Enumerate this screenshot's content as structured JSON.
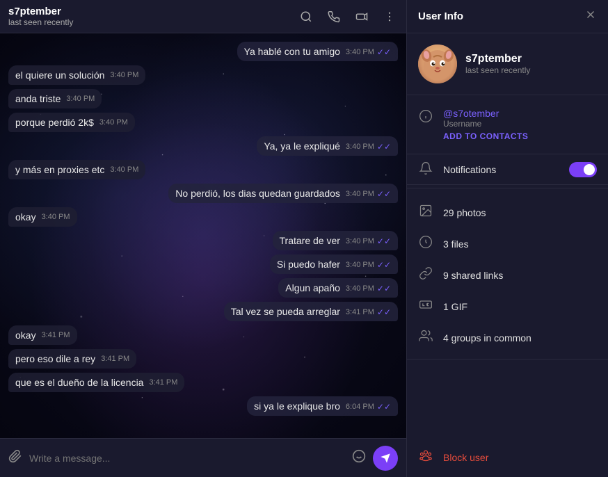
{
  "header": {
    "username": "s7ptember",
    "status": "last seen recently",
    "icons": {
      "search": "🔍",
      "call": "📞",
      "video": "📺",
      "more": "⋮"
    }
  },
  "messages": [
    {
      "id": 1,
      "type": "outgoing",
      "text": "Ya hablé con tu amigo",
      "time": "3:40 PM",
      "ticks": true
    },
    {
      "id": 2,
      "type": "incoming",
      "text": "el quiere un solución",
      "time": "3:40 PM",
      "ticks": false
    },
    {
      "id": 3,
      "type": "incoming",
      "text": "anda triste",
      "time": "3:40 PM",
      "ticks": false
    },
    {
      "id": 4,
      "type": "incoming",
      "text": "porque perdió 2k$",
      "time": "3:40 PM",
      "ticks": false
    },
    {
      "id": 5,
      "type": "outgoing",
      "text": "Ya, ya le expliqué",
      "time": "3:40 PM",
      "ticks": true
    },
    {
      "id": 6,
      "type": "incoming",
      "text": "y más en proxies etc",
      "time": "3:40 PM",
      "ticks": false
    },
    {
      "id": 7,
      "type": "outgoing",
      "text": "No perdió, los dias quedan guardados",
      "time": "3:40 PM",
      "ticks": true
    },
    {
      "id": 8,
      "type": "incoming",
      "text": "okay",
      "time": "3:40 PM",
      "ticks": false
    },
    {
      "id": 9,
      "type": "outgoing",
      "text": "Tratare de ver",
      "time": "3:40 PM",
      "ticks": true
    },
    {
      "id": 10,
      "type": "outgoing",
      "text": "Si puedo hafer",
      "time": "3:40 PM",
      "ticks": true
    },
    {
      "id": 11,
      "type": "outgoing",
      "text": "Algun apaño",
      "time": "3:40 PM",
      "ticks": true
    },
    {
      "id": 12,
      "type": "outgoing",
      "text": "Tal vez se pueda arreglar",
      "time": "3:41 PM",
      "ticks": true
    },
    {
      "id": 13,
      "type": "incoming",
      "text": "okay",
      "time": "3:41 PM",
      "ticks": false
    },
    {
      "id": 14,
      "type": "incoming",
      "text": "pero eso dile a rey",
      "time": "3:41 PM",
      "ticks": false
    },
    {
      "id": 15,
      "type": "incoming",
      "text": "que es el dueño de la licencia",
      "time": "3:41 PM",
      "ticks": false
    },
    {
      "id": 16,
      "type": "outgoing",
      "text": "si ya le explique bro",
      "time": "6:04 PM",
      "ticks": true
    }
  ],
  "input": {
    "placeholder": "Write a message..."
  },
  "userInfo": {
    "title": "User Info",
    "displayName": "s7ptember",
    "lastSeen": "last seen recently",
    "username": "@s7otember",
    "usernameLabel": "Username",
    "addToContacts": "ADD TO CONTACTS",
    "notificationsLabel": "Notifications",
    "notificationsEnabled": true,
    "media": [
      {
        "id": "photos",
        "icon": "photo",
        "label": "29 photos"
      },
      {
        "id": "files",
        "icon": "file",
        "label": "3 files"
      },
      {
        "id": "links",
        "icon": "link",
        "label": "9 shared links"
      },
      {
        "id": "gif",
        "icon": "gif",
        "label": "1 GIF"
      },
      {
        "id": "groups",
        "icon": "groups",
        "label": "4 groups in common"
      }
    ],
    "blockLabel": "Block user"
  }
}
